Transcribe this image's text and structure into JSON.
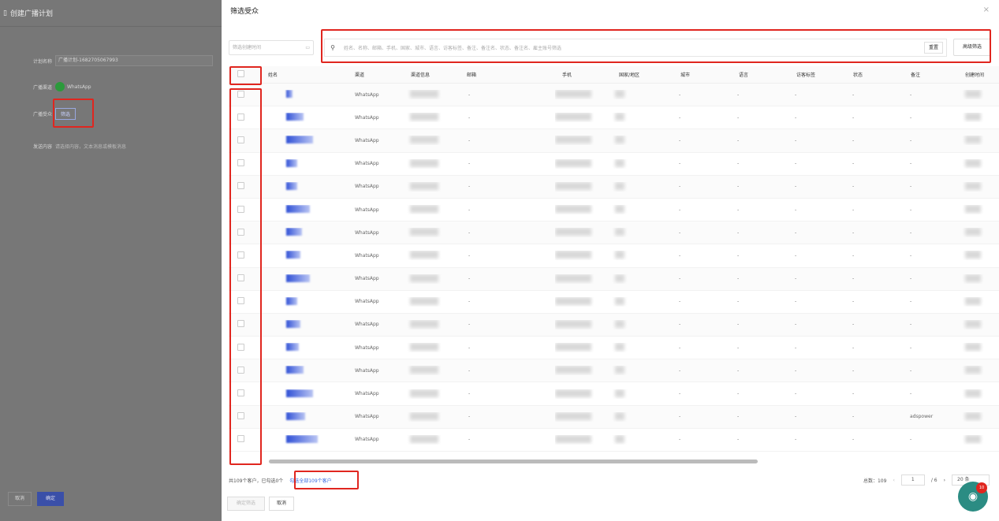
{
  "background_page": {
    "title": "创建广播计划",
    "plan_name_label": "计划名称",
    "plan_name_value": "广播计划-1682705067993",
    "channel_label": "广播渠道",
    "channel_value": "WhatsApp",
    "audience_label": "广播受众",
    "audience_button": "筛选",
    "content_label": "发送内容",
    "content_placeholder": "请选择内容，文本消息或模板消息",
    "cancel": "取消",
    "confirm": "确定"
  },
  "drawer": {
    "title": "筛选受众",
    "close": "×",
    "date_placeholder": "筛选创建时间",
    "search_placeholder": "姓名、名称、邮箱、手机、国家、城市、语言、访客标签、备注、备注名、状态、备注名、雇主账号筛选",
    "reset": "重置",
    "advanced": "高级筛选",
    "columns": [
      "姓名",
      "渠道",
      "渠道信息",
      "邮箱",
      "手机",
      "国家/地区",
      "城市",
      "语言",
      "访客标签",
      "状态",
      "备注",
      "创建时间"
    ],
    "channel_value": "WhatsApp",
    "dash": "-",
    "remark_special": "adspower",
    "footer_text": "共109个客户，已勾选0个",
    "select_all_link": "勾选全部109个客户",
    "total_label": "总数：109",
    "current_page": "1",
    "page_sep": "/ 6",
    "page_size": "20 条",
    "prev": "‹",
    "next": "›",
    "confirm_filter": "确定筛选",
    "cancel": "取消",
    "chat_badge": "10"
  }
}
